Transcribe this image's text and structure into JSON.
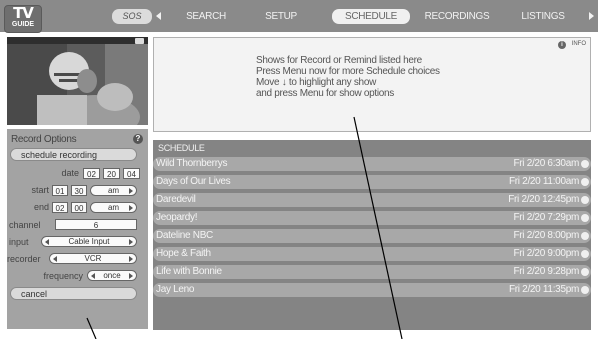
{
  "logo": {
    "line1": "TV",
    "line2": "GUIDE"
  },
  "nav": {
    "back": "SOS",
    "items": [
      "SEARCH",
      "SETUP",
      "SCHEDULE",
      "RECORDINGS",
      "LISTINGS"
    ],
    "selected": "SCHEDULE"
  },
  "info": {
    "icon_label": "INFO",
    "lines": [
      "Shows for Record or Remind listed here",
      "Press Menu now for more Schedule choices",
      "Move ↓ to highlight any show",
      "and press Menu for show options"
    ]
  },
  "record_options": {
    "title": "Record Options",
    "help_icon": "help-icon",
    "schedule_button": "schedule recording",
    "date_label": "date",
    "date": [
      "02",
      "20",
      "04"
    ],
    "start_label": "start",
    "start": [
      "01",
      "30",
      "am"
    ],
    "end_label": "end",
    "end": [
      "02",
      "00",
      "am"
    ],
    "channel_label": "channel",
    "channel": "6",
    "input_label": "input",
    "input": "Cable Input",
    "recorder_label": "recorder",
    "recorder": "VCR",
    "frequency_label": "frequency",
    "frequency": "once",
    "cancel_button": "cancel"
  },
  "schedule": {
    "heading": "SCHEDULE",
    "rows": [
      {
        "title": "Wild Thornberrys",
        "time": "Fri 2/20   6:30am"
      },
      {
        "title": "Days of Our Lives",
        "time": "Fri 2/20  11:00am"
      },
      {
        "title": "Daredevil",
        "time": "Fri 2/20  12:45pm"
      },
      {
        "title": "Jeopardy!",
        "time": "Fri 2/20   7:29pm"
      },
      {
        "title": "Dateline NBC",
        "time": "Fri 2/20   8:00pm"
      },
      {
        "title": "Hope & Faith",
        "time": "Fri 2/20   9:00pm"
      },
      {
        "title": "Life with Bonnie",
        "time": "Fri 2/20   9:28pm"
      },
      {
        "title": "Jay Leno",
        "time": "Fri 2/20  11:35pm"
      }
    ]
  },
  "colors": {
    "top_bar": "#8a8a8a",
    "schedule_bg": "#848484",
    "row_bg": "#a8a8a8",
    "panel_bg": "#a3a3a3"
  }
}
